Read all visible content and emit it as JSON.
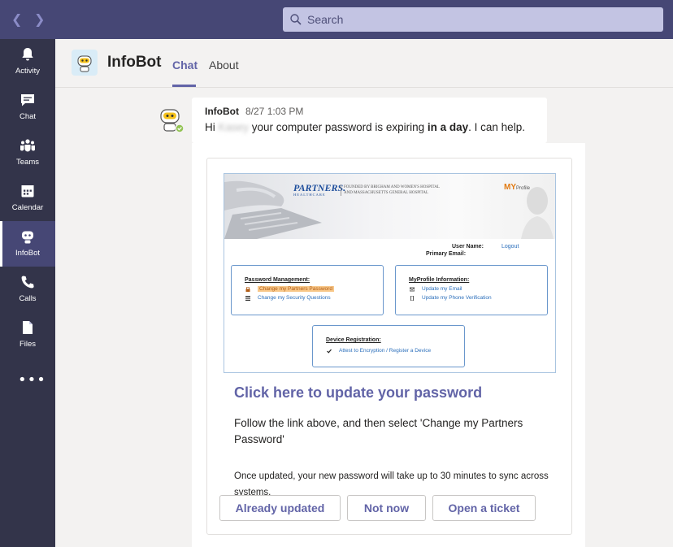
{
  "topbar": {
    "back_icon": "chevron-left-icon",
    "forward_icon": "chevron-right-icon",
    "search_placeholder": "Search"
  },
  "rail": {
    "items": [
      {
        "label": "Activity",
        "icon": "bell-icon"
      },
      {
        "label": "Chat",
        "icon": "chat-icon"
      },
      {
        "label": "Teams",
        "icon": "teams-icon"
      },
      {
        "label": "Calendar",
        "icon": "calendar-icon"
      },
      {
        "label": "InfoBot",
        "icon": "bot-icon",
        "active": true
      },
      {
        "label": "Calls",
        "icon": "phone-icon"
      },
      {
        "label": "Files",
        "icon": "file-icon"
      }
    ],
    "more": "•••"
  },
  "header": {
    "title": "InfoBot",
    "tabs": [
      {
        "label": "Chat",
        "active": true
      },
      {
        "label": "About",
        "active": false
      }
    ]
  },
  "message": {
    "sender": "InfoBot",
    "time": "8/27 1:03 PM",
    "text_before": "Hi ",
    "redacted_name": "Kasey",
    "text_middle": " your computer password is expiring ",
    "text_bold": "in a day",
    "text_after": ". I can help."
  },
  "portal": {
    "logo": "PARTNERS.",
    "logo_sub": "HEALTHCARE",
    "founded_line1": "FOUNDED BY BRIGHAM AND WOMEN'S HOSPITAL",
    "founded_line2": "AND MASSACHUSETTS GENERAL HOSPITAL",
    "myprofile_my": "MY",
    "myprofile_profile": "Profile",
    "user_name_label": "User Name:",
    "logout": "Logout",
    "primary_email_label": "Primary Email:",
    "password_mgmt": {
      "title": "Password Management:",
      "links": [
        "Change my Partners Password",
        "Change my Security Questions"
      ]
    },
    "myprofile_info": {
      "title": "MyProfile Information:",
      "links": [
        "Update my Email",
        "Update my Phone Verification"
      ]
    },
    "device_reg": {
      "title": "Device Registration:",
      "links": [
        "Attest to Encryption / Register a Device"
      ]
    }
  },
  "card": {
    "link_text": "Click here to update your password",
    "body": "Follow the link above, and then select 'Change my Partners Password'",
    "note": "Once updated, your new password will take up to 30 minutes to sync across systems.",
    "buttons": [
      "Already updated",
      "Not now",
      "Open a ticket"
    ]
  },
  "colors": {
    "accent": "#6264a7",
    "topbar": "#464775",
    "rail": "#33344a",
    "presence": "#92c353"
  }
}
